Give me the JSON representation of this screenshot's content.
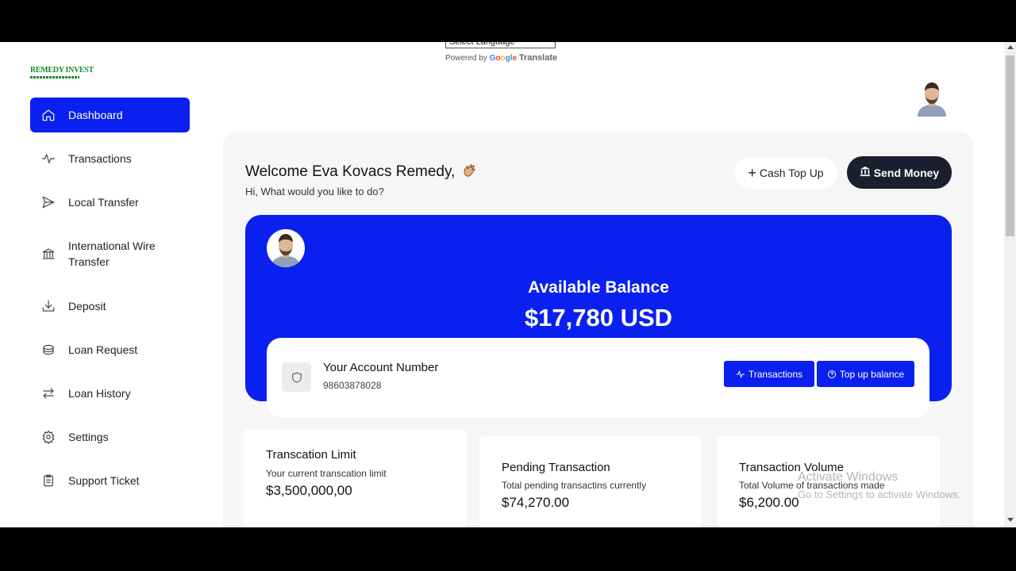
{
  "translate": {
    "select_value": "Select Language",
    "powered_by": "Powered by",
    "google_g": "G",
    "google_o1": "o",
    "google_o2": "o",
    "google_g2": "g",
    "google_l": "l",
    "google_e": "e",
    "translate_label": "Translate"
  },
  "brand": {
    "logo_text": "REMEDY INVEST",
    "color": "#1a8c2c"
  },
  "sidebar": {
    "items": [
      {
        "label": "Dashboard",
        "icon": "home-icon",
        "active": true
      },
      {
        "label": "Transactions",
        "icon": "activity-icon"
      },
      {
        "label": "Local Transfer",
        "icon": "send-icon"
      },
      {
        "label": "International Wire Transfer",
        "icon": "bank-icon"
      },
      {
        "label": "Deposit",
        "icon": "download-icon"
      },
      {
        "label": "Loan Request",
        "icon": "coins-icon"
      },
      {
        "label": "Loan History",
        "icon": "swap-icon"
      },
      {
        "label": "Settings",
        "icon": "gear-icon"
      },
      {
        "label": "Support Ticket",
        "icon": "clipboard-icon"
      }
    ]
  },
  "header": {
    "welcome": "Welcome Eva Kovacs Remedy,",
    "subtitle": "Hi, What would you like to do?",
    "cash_top_up": "Cash Top Up",
    "send_money": "Send Money"
  },
  "balance": {
    "label": "Available Balance",
    "value": "$17,780 USD"
  },
  "account": {
    "title": "Your Account Number",
    "number": "98603878028",
    "transactions_button": "Transactions",
    "top_up_button": "Top up balance"
  },
  "stats": [
    {
      "title": "Transcation Limit",
      "sub": "Your current transcation limit",
      "value": "$3,500,000,00"
    },
    {
      "title": "Pending Transaction",
      "sub": "Total pending transactins currently",
      "value": "$74,270.00"
    },
    {
      "title": "Transaction Volume",
      "sub": "Total Volume of transactions made",
      "value": "$6,200.00"
    }
  ],
  "watermark": {
    "line1": "Activate Windows",
    "line2": "Go to Settings to activate Windows."
  },
  "colors": {
    "accent": "#0a20f0",
    "dark_button": "#1b1f2e",
    "panel": "#f6f6f6"
  }
}
